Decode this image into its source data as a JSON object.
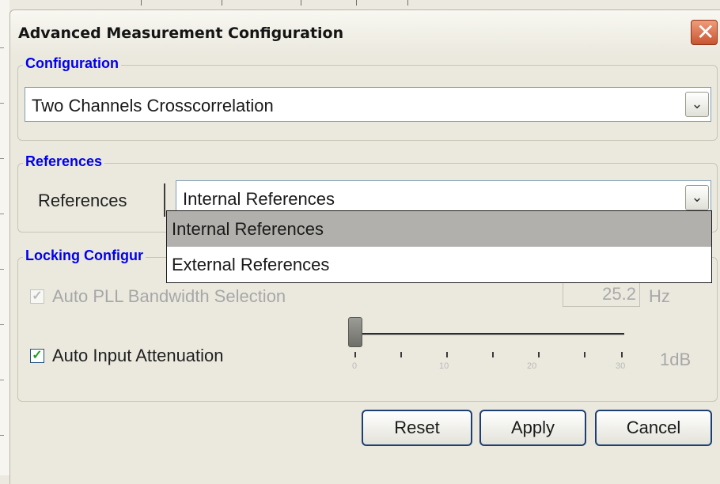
{
  "window": {
    "title": "Advanced Measurement Configuration",
    "close_glyph": "✕"
  },
  "configuration": {
    "legend": "Configuration",
    "selected": "Two Channels Crosscorrelation",
    "arrow": "⌄"
  },
  "references": {
    "legend": "References",
    "label": "References",
    "selected": "Internal References",
    "arrow": "⌄",
    "options": [
      "Internal References",
      "External References"
    ]
  },
  "locking": {
    "legend": "Locking Configur",
    "auto_pll": {
      "label": "Auto PLL Bandwidth Selection",
      "checked": true,
      "enabled": false,
      "value": "25.2",
      "unit": "Hz",
      "check_glyph": "✓"
    },
    "auto_input": {
      "label": "Auto Input Attenuation",
      "checked": true,
      "check_glyph": "✓",
      "slider_value": 0,
      "slider_min": 0,
      "slider_max": 30,
      "tick_labels": [
        "0",
        "10",
        "20",
        "30"
      ],
      "value_label": "1dB"
    }
  },
  "buttons": {
    "reset": "Reset",
    "apply": "Apply",
    "cancel": "Cancel"
  },
  "colors": {
    "legend": "#0000ee",
    "close": "#c95430",
    "dropdown_selected": "#b1b0ac",
    "check": "#21a121"
  }
}
